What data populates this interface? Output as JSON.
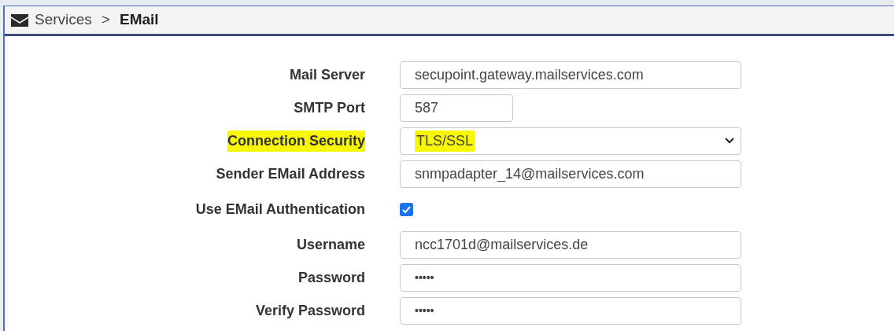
{
  "breadcrumb": {
    "parent": "Services",
    "separator": ">",
    "current": "EMail"
  },
  "fields": [
    {
      "kind": "text",
      "label": "Mail Server",
      "value": "secupoint.gateway.mailservices.com",
      "highlighted": false,
      "short": false
    },
    {
      "kind": "text",
      "label": "SMTP Port",
      "value": "587",
      "highlighted": false,
      "short": true
    },
    {
      "kind": "select",
      "label": "Connection Security",
      "value": "TLS/SSL",
      "highlighted": true,
      "short": false
    },
    {
      "kind": "text",
      "label": "Sender EMail Address",
      "value": "snmpadapter_14@mailservices.com",
      "highlighted": false,
      "short": false
    },
    {
      "kind": "checkbox",
      "label": "Use EMail Authentication",
      "checked": true,
      "highlighted": false
    },
    {
      "kind": "text",
      "label": "Username",
      "value": "ncc1701d@mailservices.de",
      "highlighted": false,
      "short": false
    },
    {
      "kind": "password",
      "label": "Password",
      "value": "•••••",
      "highlighted": false,
      "short": false
    },
    {
      "kind": "password",
      "label": "Verify Password",
      "value": "•••••",
      "highlighted": false,
      "short": false
    }
  ]
}
